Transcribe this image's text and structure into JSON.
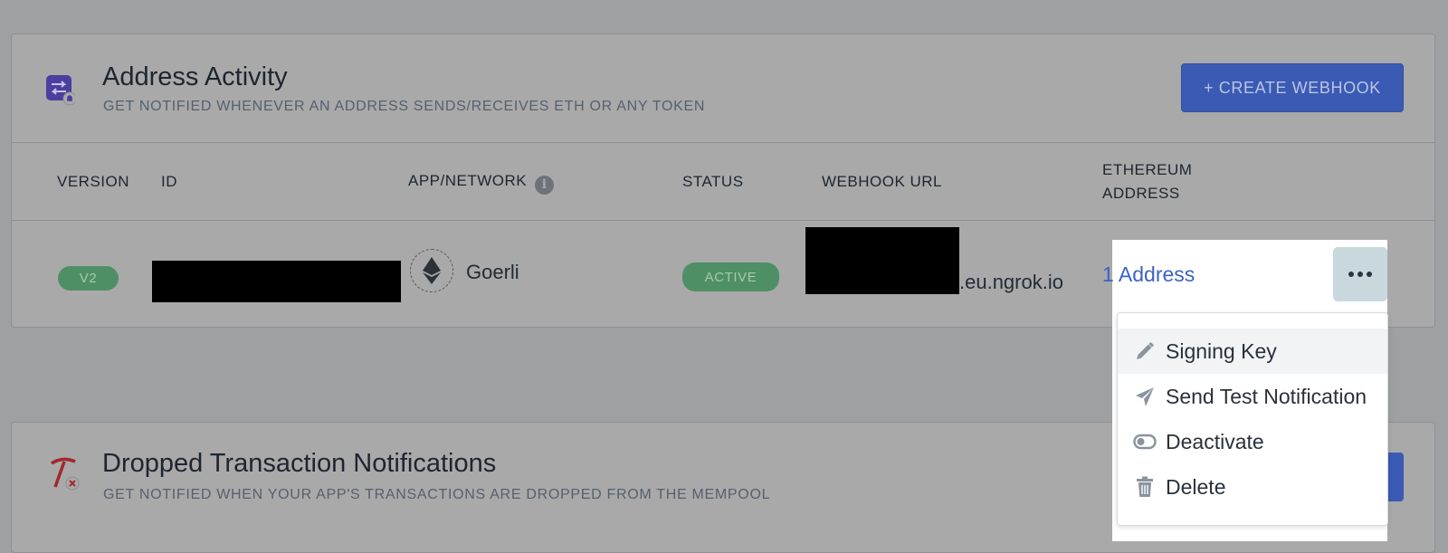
{
  "address_activity": {
    "title": "Address Activity",
    "subtitle": "GET NOTIFIED WHENEVER AN ADDRESS SENDS/RECEIVES ETH OR ANY TOKEN",
    "icon": "swap-arrows-bell-icon",
    "create_button": "+ CREATE WEBHOOK",
    "columns": {
      "version": "VERSION",
      "id": "ID",
      "app_network": "APP/NETWORK",
      "status": "STATUS",
      "webhook_url": "WEBHOOK URL",
      "eth_address_line1": "ETHEREUM",
      "eth_address_line2": "ADDRESS"
    },
    "row": {
      "version": "V2",
      "network": "Goerli",
      "status": "ACTIVE",
      "webhook_url_suffix": ".eu.ngrok.io",
      "address_link": "1 Address"
    }
  },
  "dropdown_menu": {
    "items": [
      {
        "label": "Signing Key",
        "icon": "pencil-icon"
      },
      {
        "label": "Send Test Notification",
        "icon": "paper-plane-icon"
      },
      {
        "label": "Deactivate",
        "icon": "toggle-icon"
      },
      {
        "label": "Delete",
        "icon": "trash-icon"
      }
    ]
  },
  "dropped_tx": {
    "title": "Dropped Transaction Notifications",
    "subtitle": "GET NOTIFIED WHEN YOUR APP'S TRANSACTIONS ARE DROPPED FROM THE MEMPOOL",
    "icon": "pickaxe-x-icon"
  },
  "colors": {
    "accent_blue": "#3b5ab4",
    "status_green": "#4f8f65",
    "link_blue": "#3c62c4"
  }
}
